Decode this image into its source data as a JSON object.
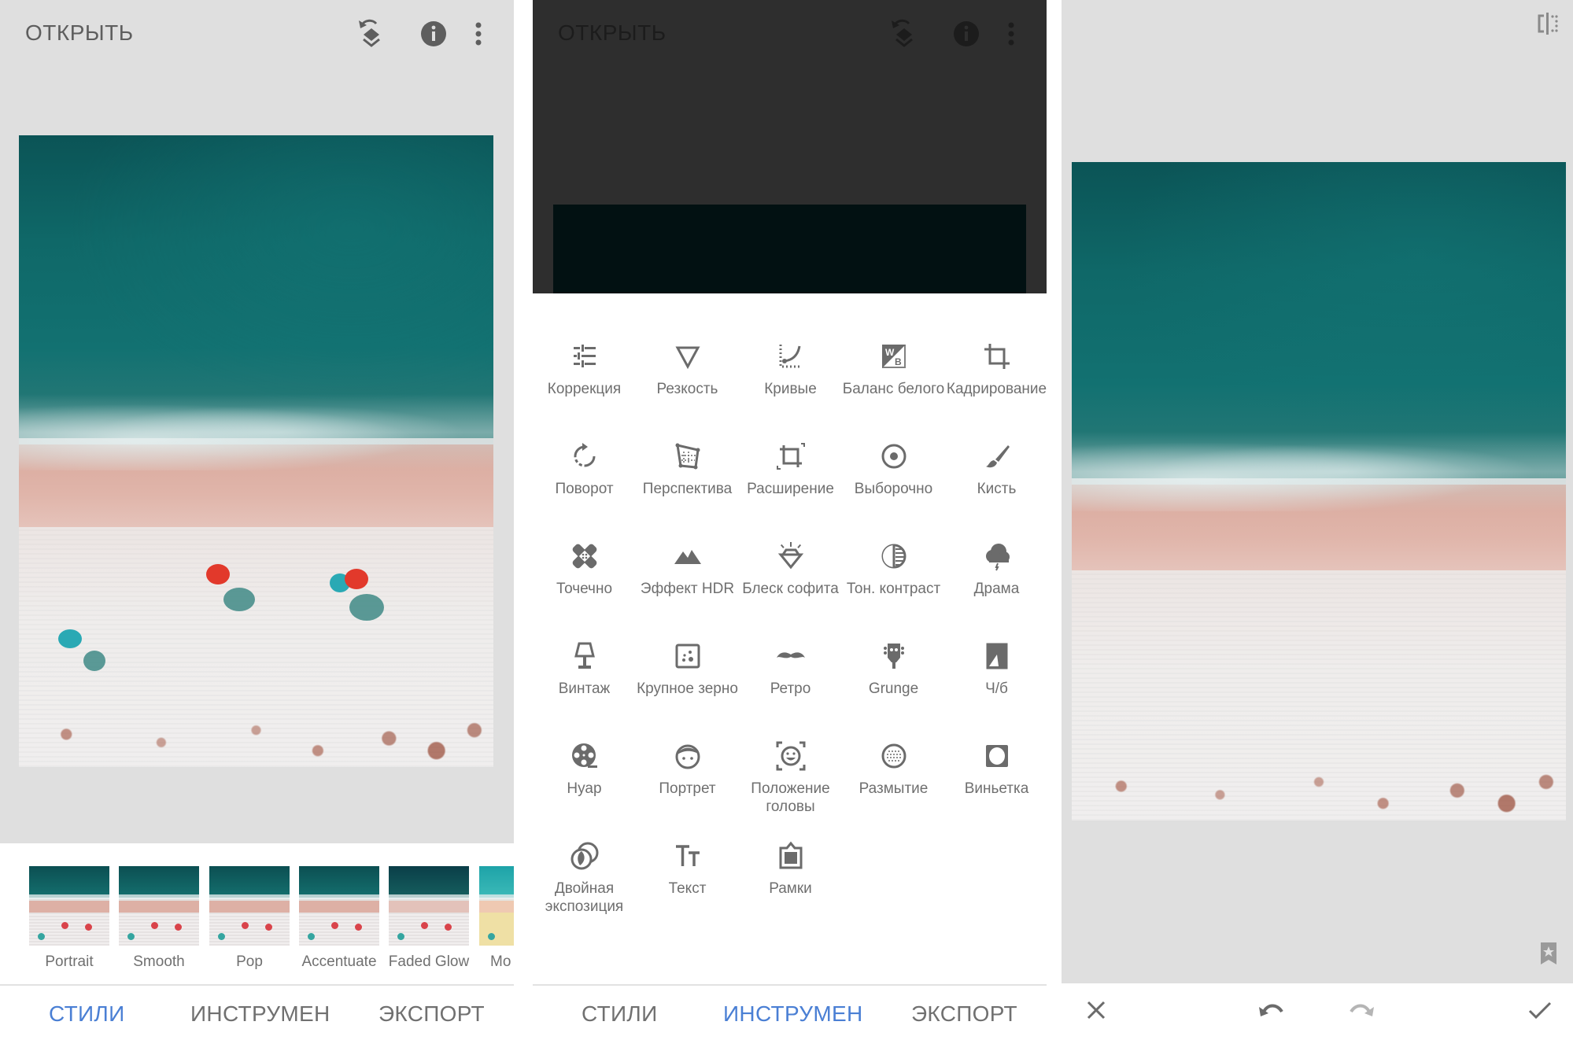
{
  "colors": {
    "accent": "#4a7fd4",
    "canvas_bg": "#dfdfdf",
    "text": "#6b6b6b",
    "dark_overlay": "#2e2e2e"
  },
  "panels": {
    "styles": {
      "topbar": {
        "open_label": "ОТКРЫТЬ",
        "icons": [
          "undo-stack-icon",
          "info-icon",
          "more-vert-icon"
        ]
      },
      "style_thumbs": [
        {
          "label": "Portrait"
        },
        {
          "label": "Smooth"
        },
        {
          "label": "Pop"
        },
        {
          "label": "Accentuate"
        },
        {
          "label": "Faded Glow"
        },
        {
          "label": "Mo"
        }
      ],
      "nav": {
        "tabs": [
          {
            "label": "СТИЛИ",
            "active": true
          },
          {
            "label": "ИНСТРУМЕН",
            "active": false
          },
          {
            "label": "ЭКСПОРТ",
            "active": false
          }
        ]
      }
    },
    "tools": {
      "topbar": {
        "open_label": "ОТКРЫТЬ",
        "icons": [
          "undo-stack-icon",
          "info-icon",
          "more-vert-icon"
        ]
      },
      "items": [
        {
          "label": "Коррекция",
          "icon": "tune-icon"
        },
        {
          "label": "Резкость",
          "icon": "sharpen-icon"
        },
        {
          "label": "Кривые",
          "icon": "curves-icon"
        },
        {
          "label": "Баланс белого",
          "icon": "white-balance-icon"
        },
        {
          "label": "Кадрирование",
          "icon": "crop-icon"
        },
        {
          "label": "Поворот",
          "icon": "rotate-icon"
        },
        {
          "label": "Перспектива",
          "icon": "perspective-icon"
        },
        {
          "label": "Расширение",
          "icon": "expand-icon"
        },
        {
          "label": "Выборочно",
          "icon": "selective-icon"
        },
        {
          "label": "Кисть",
          "icon": "brush-icon"
        },
        {
          "label": "Точечно",
          "icon": "healing-icon"
        },
        {
          "label": "Эффект HDR",
          "icon": "hdr-icon"
        },
        {
          "label": "Блеск софита",
          "icon": "glamour-glow-icon"
        },
        {
          "label": "Тон. контраст",
          "icon": "tonal-contrast-icon"
        },
        {
          "label": "Драма",
          "icon": "drama-icon"
        },
        {
          "label": "Винтаж",
          "icon": "vintage-lamp-icon"
        },
        {
          "label": "Крупное зерно",
          "icon": "grainy-film-icon"
        },
        {
          "label": "Ретро",
          "icon": "retrolux-icon"
        },
        {
          "label": "Grunge",
          "icon": "grunge-icon"
        },
        {
          "label": "Ч/б",
          "icon": "black-white-icon"
        },
        {
          "label": "Нуар",
          "icon": "noir-film-reel-icon"
        },
        {
          "label": "Портрет",
          "icon": "portrait-face-icon"
        },
        {
          "label": "Положение головы",
          "icon": "head-pose-icon"
        },
        {
          "label": "Размытие",
          "icon": "lens-blur-icon"
        },
        {
          "label": "Виньетка",
          "icon": "vignette-icon"
        },
        {
          "label": "Двойная экспозиция",
          "icon": "double-exposure-icon"
        },
        {
          "label": "Текст",
          "icon": "text-icon"
        },
        {
          "label": "Рамки",
          "icon": "frames-icon"
        }
      ],
      "nav": {
        "tabs": [
          {
            "label": "СТИЛИ",
            "active": false
          },
          {
            "label": "ИНСТРУМЕН",
            "active": true
          },
          {
            "label": "ЭКСПОРТ",
            "active": false
          }
        ]
      }
    },
    "edit": {
      "icons": {
        "compare": "compare-icon",
        "bookmark": "bookmark-star-icon",
        "cancel": "close-icon",
        "undo": "undo-icon",
        "redo": "redo-icon",
        "apply": "check-icon"
      }
    }
  }
}
